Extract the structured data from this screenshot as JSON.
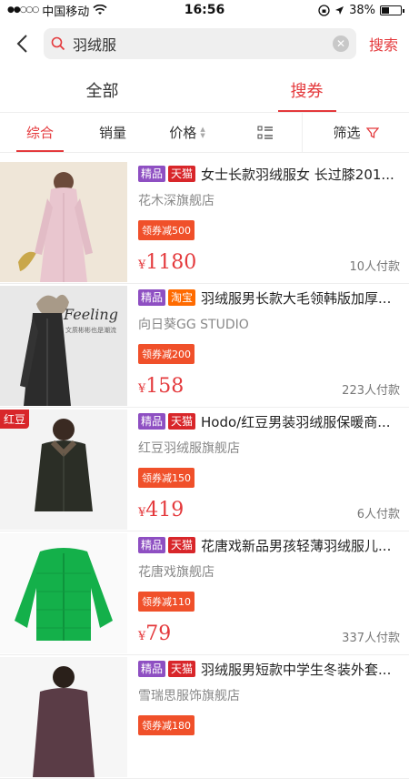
{
  "status": {
    "carrier": "中国移动",
    "time": "16:56",
    "battery": "38%",
    "battery_level": 0.38
  },
  "search": {
    "query": "羽绒服",
    "search_label": "搜索"
  },
  "tabs": [
    {
      "label": "全部"
    },
    {
      "label": "搜券"
    }
  ],
  "filters": {
    "comprehensive": "综合",
    "sales": "销量",
    "price": "价格",
    "screen": "筛选"
  },
  "products": [
    {
      "tags": [
        "精品",
        "天猫"
      ],
      "title": "女士长款羽绒服女 长过膝201...",
      "shop": "花木深旗舰店",
      "coupon": "领券减500",
      "currency": "¥",
      "price": "1180",
      "sold": "10人付款"
    },
    {
      "tags": [
        "精品",
        "淘宝"
      ],
      "title": "羽绒服男长款大毛领韩版加厚...",
      "shop": "向日葵GG STUDIO",
      "coupon": "领券减200",
      "currency": "¥",
      "price": "158",
      "sold": "223人付款",
      "image_text": "Feeling",
      "image_subtext": "文质彬彬也是潮流"
    },
    {
      "tags": [
        "精品",
        "天猫"
      ],
      "title": "Hodo/红豆男装羽绒服保暖商...",
      "shop": "红豆羽绒服旗舰店",
      "coupon": "领券减150",
      "currency": "¥",
      "price": "419",
      "sold": "6人付款",
      "image_badge": "红豆"
    },
    {
      "tags": [
        "精品",
        "天猫"
      ],
      "title": "花唐戏新品男孩轻薄羽绒服儿...",
      "shop": "花唐戏旗舰店",
      "coupon": "领券减110",
      "currency": "¥",
      "price": "79",
      "sold": "337人付款"
    },
    {
      "tags": [
        "精品",
        "天猫"
      ],
      "title": "羽绒服男短款中学生冬装外套...",
      "shop": "雪瑞思服饰旗舰店",
      "coupon": "领券减180",
      "currency": "¥",
      "price": "",
      "sold": ""
    }
  ]
}
